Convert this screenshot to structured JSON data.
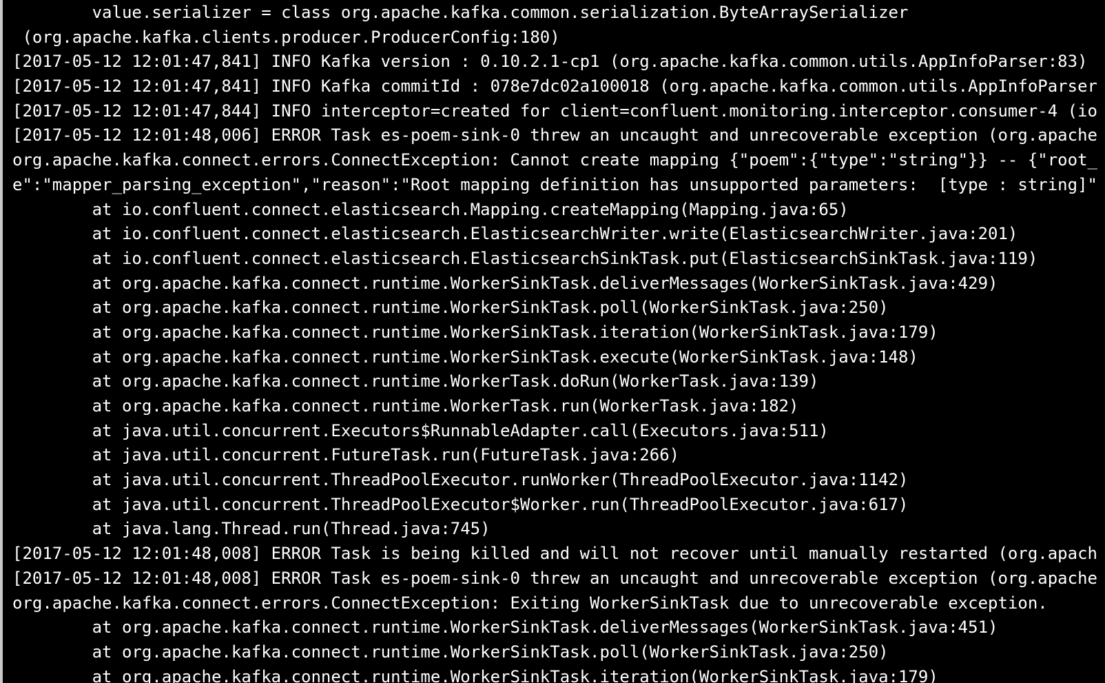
{
  "terminal": {
    "lines": [
      "        value.serializer = class org.apache.kafka.common.serialization.ByteArraySerializer",
      " (org.apache.kafka.clients.producer.ProducerConfig:180)",
      "[2017-05-12 12:01:47,841] INFO Kafka version : 0.10.2.1-cp1 (org.apache.kafka.common.utils.AppInfoParser:83)",
      "[2017-05-12 12:01:47,841] INFO Kafka commitId : 078e7dc02a100018 (org.apache.kafka.common.utils.AppInfoParser",
      "[2017-05-12 12:01:47,844] INFO interceptor=created for client=confluent.monitoring.interceptor.consumer-4 (io",
      "[2017-05-12 12:01:48,006] ERROR Task es-poem-sink-0 threw an uncaught and unrecoverable exception (org.apache",
      "org.apache.kafka.connect.errors.ConnectException: Cannot create mapping {\"poem\":{\"type\":\"string\"}} -- {\"root_",
      "e\":\"mapper_parsing_exception\",\"reason\":\"Root mapping definition has unsupported parameters:  [type : string]\"",
      "        at io.confluent.connect.elasticsearch.Mapping.createMapping(Mapping.java:65)",
      "        at io.confluent.connect.elasticsearch.ElasticsearchWriter.write(ElasticsearchWriter.java:201)",
      "        at io.confluent.connect.elasticsearch.ElasticsearchSinkTask.put(ElasticsearchSinkTask.java:119)",
      "        at org.apache.kafka.connect.runtime.WorkerSinkTask.deliverMessages(WorkerSinkTask.java:429)",
      "        at org.apache.kafka.connect.runtime.WorkerSinkTask.poll(WorkerSinkTask.java:250)",
      "        at org.apache.kafka.connect.runtime.WorkerSinkTask.iteration(WorkerSinkTask.java:179)",
      "        at org.apache.kafka.connect.runtime.WorkerSinkTask.execute(WorkerSinkTask.java:148)",
      "        at org.apache.kafka.connect.runtime.WorkerTask.doRun(WorkerTask.java:139)",
      "        at org.apache.kafka.connect.runtime.WorkerTask.run(WorkerTask.java:182)",
      "        at java.util.concurrent.Executors$RunnableAdapter.call(Executors.java:511)",
      "        at java.util.concurrent.FutureTask.run(FutureTask.java:266)",
      "        at java.util.concurrent.ThreadPoolExecutor.runWorker(ThreadPoolExecutor.java:1142)",
      "        at java.util.concurrent.ThreadPoolExecutor$Worker.run(ThreadPoolExecutor.java:617)",
      "        at java.lang.Thread.run(Thread.java:745)",
      "[2017-05-12 12:01:48,008] ERROR Task is being killed and will not recover until manually restarted (org.apach",
      "[2017-05-12 12:01:48,008] ERROR Task es-poem-sink-0 threw an uncaught and unrecoverable exception (org.apache",
      "org.apache.kafka.connect.errors.ConnectException: Exiting WorkerSinkTask due to unrecoverable exception.",
      "        at org.apache.kafka.connect.runtime.WorkerSinkTask.deliverMessages(WorkerSinkTask.java:451)",
      "        at org.apache.kafka.connect.runtime.WorkerSinkTask.poll(WorkerSinkTask.java:250)",
      "        at org.apache.kafka.connect.runtime.WorkerSinkTask.iteration(WorkerSinkTask.java:179)"
    ]
  },
  "colors": {
    "background": "#000000",
    "text": "#ffffff",
    "window_edge": "#c8c8c8"
  }
}
